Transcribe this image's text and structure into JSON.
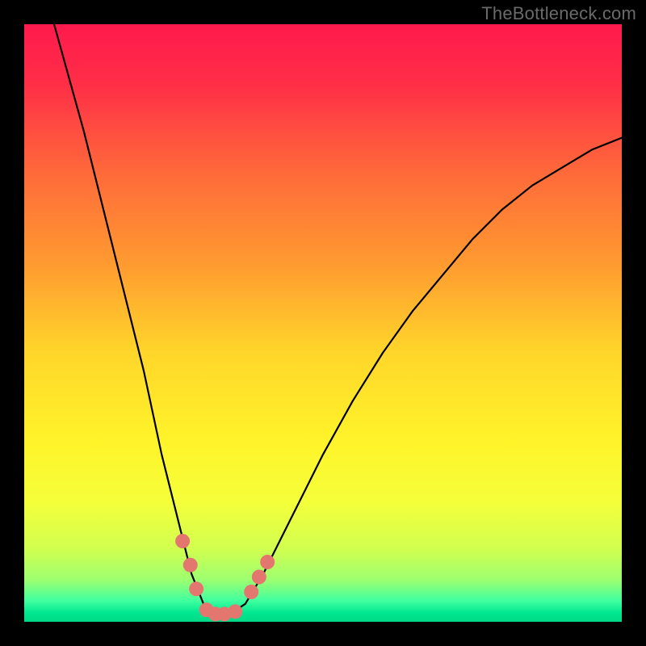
{
  "watermark": "TheBottleneck.com",
  "chart_data": {
    "type": "line",
    "title": "",
    "xlabel": "",
    "ylabel": "",
    "xlim": [
      0,
      100
    ],
    "ylim": [
      0,
      100
    ],
    "series": [
      {
        "name": "bottleneck-curve",
        "x": [
          5,
          10,
          15,
          20,
          23,
          26,
          28,
          30,
          32,
          34,
          37,
          40,
          45,
          50,
          55,
          60,
          65,
          70,
          75,
          80,
          85,
          90,
          95,
          100
        ],
        "y": [
          100,
          82,
          62,
          42,
          28,
          16,
          8,
          3,
          1,
          1,
          3,
          8,
          18,
          28,
          37,
          45,
          52,
          58,
          64,
          69,
          73,
          76,
          79,
          81
        ]
      }
    ],
    "markers": [
      {
        "x": 26.5,
        "y": 13.5
      },
      {
        "x": 27.8,
        "y": 9.5
      },
      {
        "x": 28.8,
        "y": 5.5
      },
      {
        "x": 30.5,
        "y": 2.0
      },
      {
        "x": 32.0,
        "y": 1.3
      },
      {
        "x": 33.5,
        "y": 1.3
      },
      {
        "x": 35.3,
        "y": 1.7
      },
      {
        "x": 38.0,
        "y": 5.0
      },
      {
        "x": 39.3,
        "y": 7.5
      },
      {
        "x": 40.7,
        "y": 10.0
      }
    ],
    "gradient_stops": [
      {
        "offset": 0.0,
        "color": "#ff1a4d"
      },
      {
        "offset": 0.1,
        "color": "#ff2e47"
      },
      {
        "offset": 0.25,
        "color": "#ff6a3a"
      },
      {
        "offset": 0.4,
        "color": "#ff9a30"
      },
      {
        "offset": 0.55,
        "color": "#ffd62a"
      },
      {
        "offset": 0.7,
        "color": "#fff42a"
      },
      {
        "offset": 0.8,
        "color": "#f4ff3a"
      },
      {
        "offset": 0.88,
        "color": "#d0ff50"
      },
      {
        "offset": 0.93,
        "color": "#9cff70"
      },
      {
        "offset": 0.965,
        "color": "#40ffa0"
      },
      {
        "offset": 0.985,
        "color": "#00e890"
      },
      {
        "offset": 1.0,
        "color": "#00d885"
      }
    ],
    "marker_color": "#e3776f",
    "curve_color": "#000000"
  }
}
